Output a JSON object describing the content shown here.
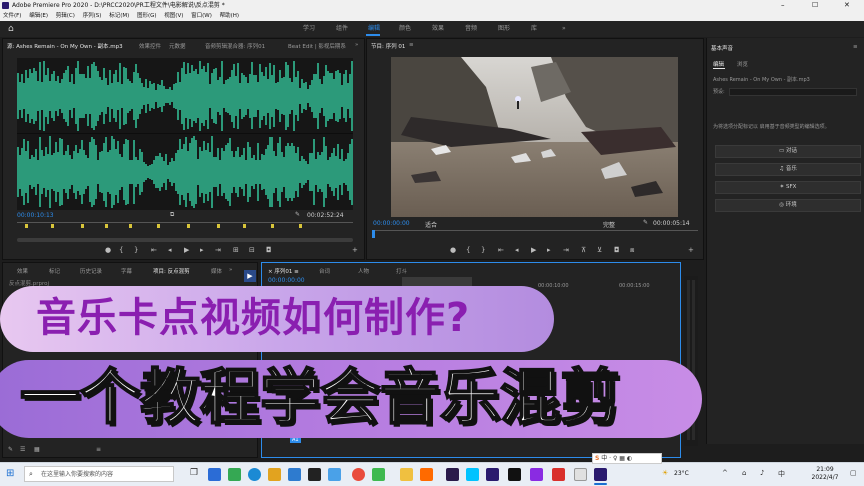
{
  "window": {
    "title": "Adobe Premiere Pro 2020 - D:\\PRCC2020\\PR工程文件\\电影解说\\反点混剪 *",
    "min_glyph": "–",
    "max_glyph": "☐",
    "close_glyph": "✕"
  },
  "menu": [
    "文件(F)",
    "编辑(E)",
    "剪辑(C)",
    "序列(S)",
    "标记(M)",
    "图形(G)",
    "视图(V)",
    "窗口(W)",
    "帮助(H)"
  ],
  "workspaces": [
    "学习",
    "组件",
    "编辑",
    "颜色",
    "效果",
    "音频",
    "图形",
    "库"
  ],
  "workspace_active": "编辑",
  "workspace_more": "»",
  "source_panel": {
    "tabs": [
      "源: Ashes Remain - On My Own - 副本.mp3",
      "效果控件",
      "元数据",
      "音频剪辑混合器: 序列01",
      "Beat Edit | 影视后期系"
    ],
    "more": "»",
    "timecode_in": "00:00:10:13",
    "timecode_dur": "00:02:52:24",
    "fit_icon": "wrench-icon"
  },
  "program_panel": {
    "tab": "节目: 序列 01",
    "menu": "≡",
    "timecode_in": "00:00:00:00",
    "fit_label": "适合",
    "quality_label": "完整",
    "timecode_dur": "00:00:05:14"
  },
  "project_panel": {
    "tabs": [
      "效果",
      "标记",
      "历史记录",
      "字幕",
      "项目: 反点混剪",
      "媒体"
    ],
    "more": "»",
    "item": "反点混剪.prproj"
  },
  "timeline_panel": {
    "tabs": [
      "× 序列01 ≡",
      "台词",
      "人物",
      "打斗"
    ],
    "timecode": "00:00:00:00",
    "ruler": [
      "00:00:10:00",
      "00:00:15:00"
    ],
    "track_label": "A1"
  },
  "essential_sound": {
    "title": "基本声音",
    "menu": "≡",
    "tabs": [
      "编辑",
      "浏览"
    ],
    "clip": "Ashes Remain - On My Own - 副本.mp3",
    "preset_label": "预设:",
    "hint": "为将选项分配标记以 启用基于音频类型的编辑选项。",
    "buttons": [
      "对话",
      "音乐",
      "SFX",
      "环境"
    ],
    "button_icons": [
      "dialogue-icon",
      "music-icon",
      "sfx-icon",
      "ambience-icon"
    ]
  },
  "banner": {
    "line1": "音乐卡点视频如何制作?",
    "line2": "一个教程学会音乐混剪"
  },
  "taskbar": {
    "search_placeholder": "在这里输入你要搜索的内容",
    "weather": "23°C",
    "time": "21:09",
    "date": "2022/4/7"
  },
  "colors": {
    "accent": "#2d8ceb",
    "waveform": "#2c9a7a",
    "banner_text_1": "#8a1fb0",
    "banner_bg_2": "#b57ce0"
  }
}
